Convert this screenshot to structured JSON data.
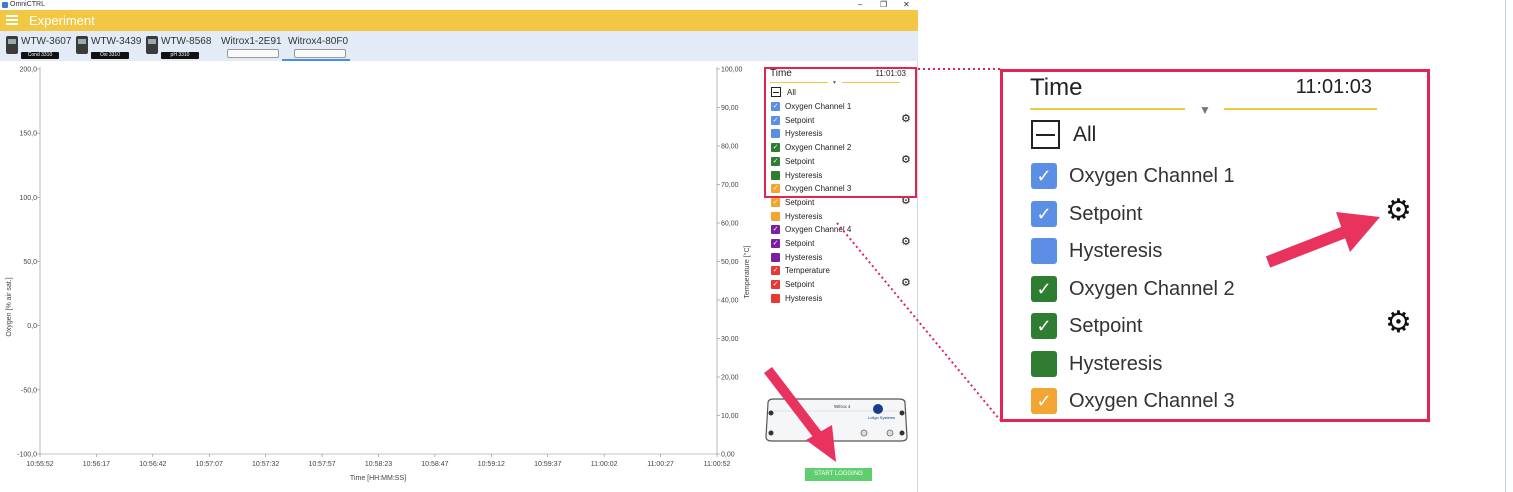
{
  "window": {
    "app_title": "OmniCTRL",
    "minimize": "‒",
    "maximize": "❐",
    "close": "✕"
  },
  "appbar": {
    "title": "Experiment"
  },
  "devices": [
    {
      "name": "WTW-3607",
      "badge": "Cond 3310"
    },
    {
      "name": "WTW-3439",
      "badge": "Oxi 3310"
    },
    {
      "name": "WTW-8568",
      "badge": "pH 3310"
    },
    {
      "name": "Witrox1-2E91"
    },
    {
      "name": "Witrox4-80F0"
    }
  ],
  "chart": {
    "y_left_label": "Oxygen [% air sat.]",
    "y_right_label": "Temperature [°C]",
    "x_label": "Time [HH:MM:SS]",
    "y_left_ticks": [
      "200,0",
      "150,0",
      "100,0",
      "50,0",
      "0,0",
      "-50,0",
      "-100,0"
    ],
    "y_right_ticks": [
      "100,00",
      "90,00",
      "80,00",
      "70,00",
      "60,00",
      "50,00",
      "40,00",
      "30,00",
      "20,00",
      "10,00",
      "0,00"
    ],
    "x_ticks": [
      "10:55:52",
      "10:56:17",
      "10:56:42",
      "10:57:07",
      "10:57:32",
      "10:57:57",
      "10:58:23",
      "10:58:47",
      "10:59:12",
      "10:59:37",
      "11:00:02",
      "11:00:27",
      "11:00:52"
    ]
  },
  "legend": {
    "header_label": "Time",
    "header_value": "11:01:03",
    "all_label": "All",
    "items": [
      {
        "label": "Oxygen Channel 1",
        "color": "#5b8fe6",
        "check": "✓",
        "gear": ""
      },
      {
        "label": "Setpoint",
        "color": "#5b8fe6",
        "check": "✓",
        "gear": "⚙"
      },
      {
        "label": "Hysteresis",
        "color": "#5b8fe6",
        "check": "",
        "gear": ""
      },
      {
        "label": "Oxygen Channel 2",
        "color": "#2e7d32",
        "check": "✓",
        "gear": ""
      },
      {
        "label": "Setpoint",
        "color": "#2e7d32",
        "check": "✓",
        "gear": "⚙"
      },
      {
        "label": "Hysteresis",
        "color": "#2e7d32",
        "check": "",
        "gear": ""
      },
      {
        "label": "Oxygen Channel 3",
        "color": "#f2a533",
        "check": "✓",
        "gear": ""
      },
      {
        "label": "Setpoint",
        "color": "#f2a533",
        "check": "✓",
        "gear": "⚙"
      },
      {
        "label": "Hysteresis",
        "color": "#f2a533",
        "check": "",
        "gear": ""
      },
      {
        "label": "Oxygen Channel 4",
        "color": "#7b1fa2",
        "check": "✓",
        "gear": ""
      },
      {
        "label": "Setpoint",
        "color": "#7b1fa2",
        "check": "✓",
        "gear": "⚙"
      },
      {
        "label": "Hysteresis",
        "color": "#7b1fa2",
        "check": "",
        "gear": ""
      },
      {
        "label": "Temperature",
        "color": "#e53935",
        "check": "✓",
        "gear": ""
      },
      {
        "label": "Setpoint",
        "color": "#e53935",
        "check": "✓",
        "gear": "⚙"
      },
      {
        "label": "Hysteresis",
        "color": "#e53935",
        "check": "",
        "gear": ""
      }
    ]
  },
  "device_image": {
    "model": "Witrox 4",
    "brand": "Loligo Systems"
  },
  "start_button": "START LOGGING",
  "accent_color": "#f2c744",
  "highlight_color": "#e02552"
}
